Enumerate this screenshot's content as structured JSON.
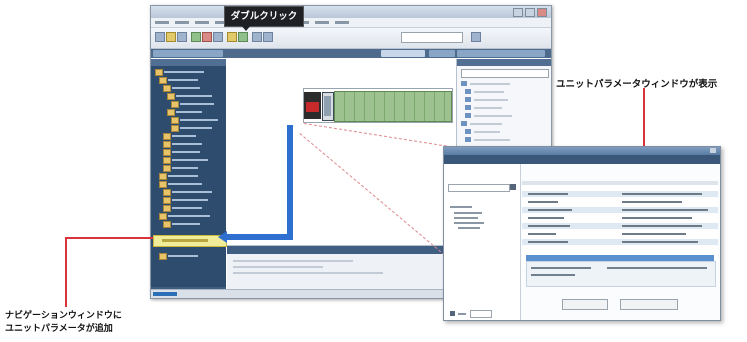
{
  "annotations": {
    "double_click": "ダブルクリック",
    "unit_param_shown": "ユニットパラメータウィンドウが表示",
    "nav_added_line1": "ナビゲーションウィンドウに",
    "nav_added_line2": "ユニットパラメータが追加"
  },
  "colors": {
    "callout_red": "#d9343b",
    "arrow_blue": "#2f6fd0",
    "navigation_bg": "#2e4d6e",
    "highlight_yellow": "#f0ec9a",
    "io_green": "#9ec28f"
  }
}
